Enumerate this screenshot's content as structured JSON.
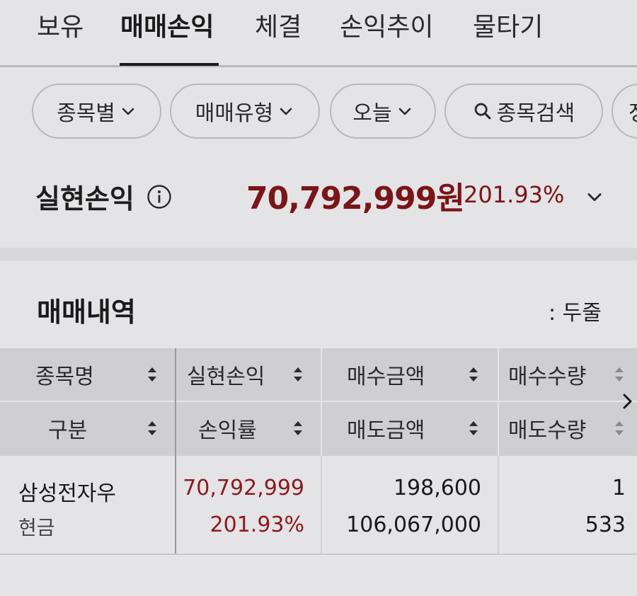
{
  "tabs": [
    {
      "label": "보유",
      "active": false
    },
    {
      "label": "매매손익",
      "active": true
    },
    {
      "label": "체결",
      "active": false
    },
    {
      "label": "손익추이",
      "active": false
    },
    {
      "label": "물타기",
      "active": false
    }
  ],
  "filters": {
    "by_stock": "종목별",
    "trade_type": "매매유형",
    "period": "오늘",
    "search": "종목검색",
    "partial_next": "정"
  },
  "summary": {
    "label": "실현손익",
    "amount": "70,792,999원",
    "rate": "201.93%"
  },
  "section": {
    "title": "매매내역",
    "view_mode": ": 두줄"
  },
  "table": {
    "headers_row1": [
      "종목명",
      "실현손익",
      "매수금액",
      "매수수량"
    ],
    "headers_row2": [
      "구분",
      "손익률",
      "매도금액",
      "매도수량"
    ],
    "rows": [
      {
        "name": "삼성전자우",
        "category": "현금",
        "realized_pl": "70,792,999",
        "pl_rate": "201.93%",
        "buy_amount": "198,600",
        "sell_amount": "106,067,000",
        "buy_qty": "1",
        "sell_qty": "533"
      }
    ]
  },
  "colors": {
    "background": "#e4e3e6",
    "profit_red": "#7a1518",
    "header_bg": "#cfced2"
  }
}
